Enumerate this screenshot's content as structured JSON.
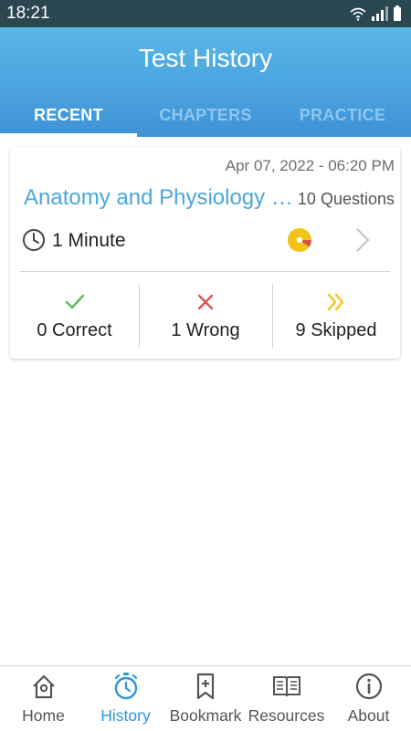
{
  "status_bar": {
    "time": "18:21",
    "icons": [
      "wifi-icon",
      "signal-icon",
      "battery-icon"
    ]
  },
  "header": {
    "title": "Test History",
    "tabs": [
      {
        "label": "RECENT",
        "active": true
      },
      {
        "label": "CHAPTERS",
        "active": false
      },
      {
        "label": "PRACTICE",
        "active": false
      }
    ]
  },
  "card": {
    "date": "Apr 07, 2022 - 06:20 PM",
    "title": "Anatomy and Physiology Chapter Test",
    "questions": "10 Questions",
    "duration": "1 Minute",
    "score_chart": {
      "correct": 0,
      "wrong": 1,
      "skipped": 9
    },
    "stats": [
      {
        "icon": "check-icon",
        "label": "0 Correct",
        "color": "#5cb85c"
      },
      {
        "icon": "cross-icon",
        "label": "1 Wrong",
        "color": "#d9534f"
      },
      {
        "icon": "double-chevron-right-icon",
        "label": "9 Skipped",
        "color": "#f0c419"
      }
    ]
  },
  "bottom_nav": {
    "items": [
      {
        "label": "Home",
        "icon": "home-icon",
        "active": false
      },
      {
        "label": "History",
        "icon": "stopwatch-icon",
        "active": true
      },
      {
        "label": "Bookmark",
        "icon": "bookmark-icon",
        "active": false
      },
      {
        "label": "Resources",
        "icon": "book-icon",
        "active": false
      },
      {
        "label": "About",
        "icon": "info-icon",
        "active": false
      }
    ]
  },
  "colors": {
    "accent": "#3f92d6",
    "active_nav": "#2b97d6",
    "title_blue": "#4aa7dc",
    "status_bar": "#2a4650",
    "pie_yellow": "#f0c419",
    "pie_red": "#d9534f"
  }
}
